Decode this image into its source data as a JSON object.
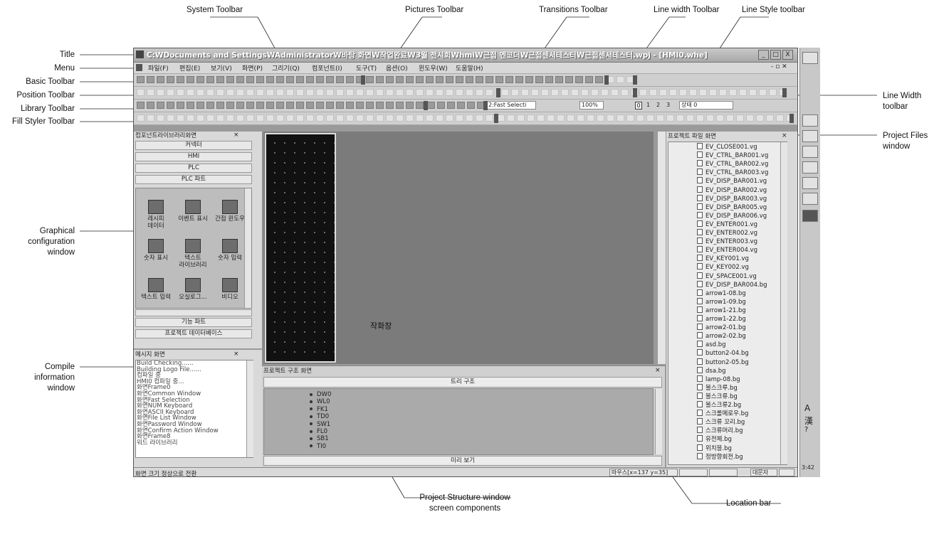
{
  "callouts": {
    "system_toolbar": "System Toolbar",
    "pictures_toolbar": "Pictures Toolbar",
    "transitions_toolbar": "Transitions Toolbar",
    "line_width_toolbar": "Line width Toolbar",
    "line_style_toolbar": "Line Style toolbar",
    "title": "Title",
    "menu": "Menu",
    "basic_toolbar": "Basic Toolbar",
    "position_toolbar": "Position Toolbar",
    "library_toolbar": "Library Toolbar",
    "fill_styler_toolbar": "Fill Styler Toolbar",
    "line_width_toolbar_right_1": "Line Width",
    "line_width_toolbar_right_2": "toolbar",
    "project_files_window_1": "Project Files",
    "project_files_window_2": "window",
    "graphical_config_1": "Graphical",
    "graphical_config_2": "configuration",
    "graphical_config_3": "window",
    "compile_info_1": "Compile",
    "compile_info_2": "information",
    "compile_info_3": "window",
    "drawing_window": "작화창",
    "project_structure_1": "Project Structure window",
    "project_structure_2": "screen components",
    "location_bar": "Location bar"
  },
  "window": {
    "title": "C:WDocuments and SettingsWAdministratorW바탕 화면W작업완료W3월 전시회WhmiW근접 엔코더W근접센서테스터W근접센서테스터.wpj - [HMI0.whe]",
    "min": "_",
    "max": "□",
    "close": "X"
  },
  "menu": [
    "파일(F)",
    "편집(E)",
    "보기(V)",
    "화면(P)",
    "그리기(Q)",
    "컴포넌트(I)",
    "도구(T)",
    "옵션(O)",
    "윈도우(W)",
    "도움말(H)"
  ],
  "toolbar": {
    "fast_select": "2:Fast Selecti",
    "zoom": "100%",
    "layer_0": "0",
    "layer_1": "1",
    "layer_2": "2",
    "layer_3": "3",
    "state": "상태 0"
  },
  "library": {
    "title": "컴포넌트라이브러리화면",
    "tabs_top": [
      "커넥터",
      "HMI",
      "PLC",
      "PLC 파트"
    ],
    "items": [
      {
        "label": "레시피\n데이터",
        "icon": "recipe-data-icon"
      },
      {
        "label": "이벤트 표시",
        "icon": "event-display-icon"
      },
      {
        "label": "간접 윈도우",
        "icon": "indirect-window-icon"
      },
      {
        "label": "숫자 표시",
        "icon": "numeric-display-icon"
      },
      {
        "label": "텍스트\n라이브러리",
        "icon": "text-library-icon"
      },
      {
        "label": "숫자 입력",
        "icon": "numeric-input-icon"
      },
      {
        "label": "텍스트 입력",
        "icon": "text-input-icon"
      },
      {
        "label": "오실로그...",
        "icon": "oscilloscope-icon"
      },
      {
        "label": "비디오",
        "icon": "video-icon"
      }
    ],
    "tabs_bottom": [
      "기능 파트",
      "프로젝트 데이터베이스"
    ]
  },
  "messages": {
    "title": "메시지 화면",
    "lines": [
      "Build Checking......",
      "Building Logo File......",
      "컴파일 중",
      "HMI0 컴파일 중...",
      "화면Frame0",
      "화면Common Window",
      "화면Fast Selection",
      "화면NUM Keyboard",
      "화면ASCII Keyboard",
      "화면File List Window",
      "화면Password Window",
      "화면Confirm Action Window",
      "화면Frame8",
      "워드 라이브러리"
    ]
  },
  "structure": {
    "title": "프로젝트 구조 화면",
    "tree_header": "트리 구조",
    "items": [
      "DW0",
      "WL0",
      "FK1",
      "TD0",
      "SW1",
      "FL0",
      "SB1",
      "TI0"
    ],
    "preview": "미리 보기"
  },
  "files": {
    "title": "프로젝트 파일 화면",
    "items": [
      "EV_CLOSE001.vg",
      "EV_CTRL_BAR001.vg",
      "EV_CTRL_BAR002.vg",
      "EV_CTRL_BAR003.vg",
      "EV_DISP_BAR001.vg",
      "EV_DISP_BAR002.vg",
      "EV_DISP_BAR003.vg",
      "EV_DISP_BAR005.vg",
      "EV_DISP_BAR006.vg",
      "EV_ENTER001.vg",
      "EV_ENTER002.vg",
      "EV_ENTER003.vg",
      "EV_ENTER004.vg",
      "EV_KEY001.vg",
      "EV_KEY002.vg",
      "EV_SPACE001.vg",
      "EV_DISP_BAR004.bg",
      "arrow1-08.bg",
      "arrow1-09.bg",
      "arrow1-21.bg",
      "arrow1-22.bg",
      "arrow2-01.bg",
      "arrow2-02.bg",
      "asd.bg",
      "button2-04.bg",
      "button2-05.bg",
      "dsa.bg",
      "lamp-08.bg",
      "볼스크루.bg",
      "볼스크류.bg",
      "볼스크류2.bg",
      "스크롤메로우.bg",
      "스크류 꼬리.bg",
      "스크류머리.bg",
      "유전체.bg",
      "위치블.bg",
      "정방향회전.bg"
    ]
  },
  "status": {
    "hint": "화면 크기 정상으로 전환",
    "mouse": "마우스[x=137  y=35]",
    "cell_a": "",
    "cell_b": "",
    "num": "대문자"
  },
  "strip": {
    "a": "A",
    "han": "漢",
    "help": "?",
    "time": "3:42"
  }
}
